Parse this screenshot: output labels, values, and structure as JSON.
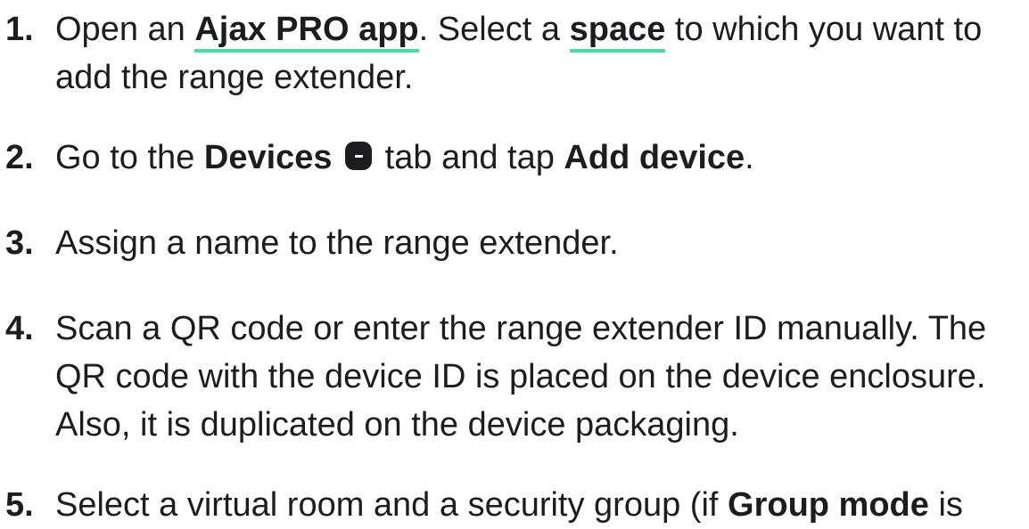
{
  "steps": [
    {
      "number": "1.",
      "parts": {
        "t1": "Open an ",
        "link1": "Ajax PRO app",
        "t2": ". Select a ",
        "link2": "space",
        "t3": " to which you want to add the range extender."
      }
    },
    {
      "number": "2.",
      "parts": {
        "t1": "Go to the ",
        "b1": "Devices",
        "t2": " tab and tap ",
        "b2": "Add device",
        "t3": "."
      },
      "icon": "devices-tab-icon"
    },
    {
      "number": "3.",
      "parts": {
        "t1": "Assign a name to the range extender."
      }
    },
    {
      "number": "4.",
      "parts": {
        "t1": "Scan a QR code or enter the range extender ID manually. The QR code with the device ID is placed on the device enclosure. Also, it is duplicated on the device packaging."
      }
    },
    {
      "number": "5.",
      "parts": {
        "t1": "Select a virtual room and a security group (if ",
        "b1": "Group mode",
        "t2": " is"
      }
    }
  ],
  "colors": {
    "text": "#1d1d1f",
    "link_underline": "#4cd9a3",
    "background": "#ffffff"
  }
}
